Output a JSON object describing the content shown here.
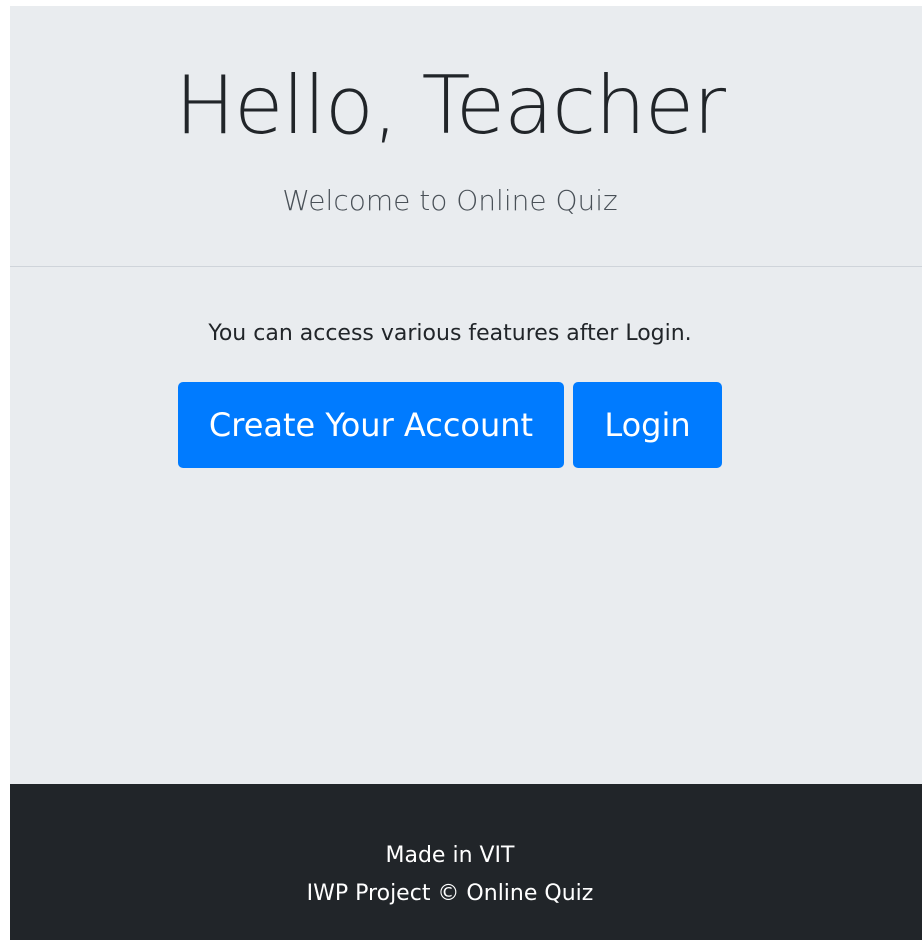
{
  "header": {
    "title": "Hello, Teacher",
    "subtitle": "Welcome to Online Quiz"
  },
  "main": {
    "info_text": "You can access various features after Login.",
    "create_account_label": "Create Your Account",
    "login_label": "Login"
  },
  "footer": {
    "line1": "Made in VIT",
    "line2": "IWP Project © Online Quiz"
  },
  "colors": {
    "page_background": "#e9ecef",
    "primary_button": "#007bff",
    "footer_background": "#212529"
  }
}
